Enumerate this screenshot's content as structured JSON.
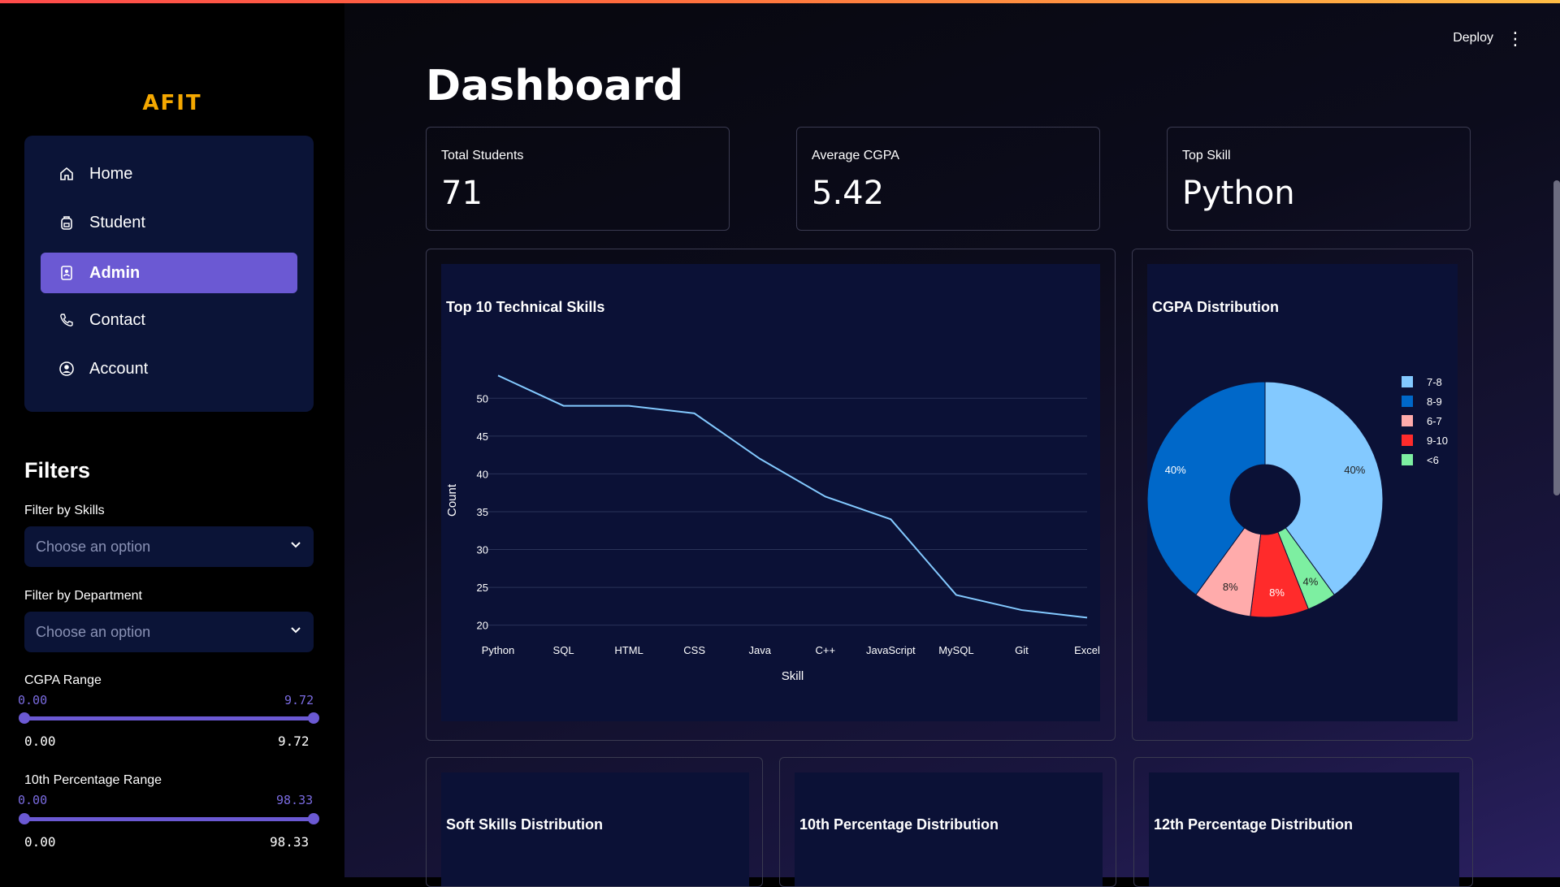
{
  "app": {
    "deploy_label": "Deploy",
    "menu_icon": "more-vertical-icon"
  },
  "sidebar": {
    "logo": "AFIT",
    "nav": [
      {
        "label": "Home",
        "icon": "home-icon"
      },
      {
        "label": "Student",
        "icon": "backpack-icon"
      },
      {
        "label": "Admin",
        "icon": "badge-icon",
        "active": true
      },
      {
        "label": "Contact",
        "icon": "phone-icon"
      },
      {
        "label": "Account",
        "icon": "user-circle-icon"
      }
    ],
    "filters_title": "Filters",
    "skills_filter": {
      "label": "Filter by Skills",
      "placeholder": "Choose an option"
    },
    "dept_filter": {
      "label": "Filter by Department",
      "placeholder": "Choose an option"
    },
    "cgpa_range": {
      "label": "CGPA Range",
      "min": "0.00",
      "max": "9.72"
    },
    "tenth_range": {
      "label": "10th Percentage Range",
      "min": "0.00",
      "max": "98.33"
    }
  },
  "main": {
    "title": "Dashboard",
    "metrics": [
      {
        "label": "Total Students",
        "value": "71"
      },
      {
        "label": "Average CGPA",
        "value": "5.42"
      },
      {
        "label": "Top Skill",
        "value": "Python"
      }
    ],
    "bottom_cards": [
      "Soft Skills Distribution",
      "10th Percentage Distribution",
      "12th Percentage Distribution"
    ]
  },
  "colors": {
    "accent": "#6b59d3",
    "line": "#83c9ff",
    "panel": "#0b1136"
  },
  "chart_data": [
    {
      "type": "line",
      "title": "Top 10 Technical Skills",
      "xlabel": "Skill",
      "ylabel": "Count",
      "categories": [
        "Python",
        "SQL",
        "HTML",
        "CSS",
        "Java",
        "C++",
        "JavaScript",
        "MySQL",
        "Git",
        "Excel"
      ],
      "values": [
        53,
        49,
        49,
        48,
        42,
        37,
        34,
        24,
        22,
        21
      ],
      "ylim": [
        19,
        54
      ],
      "yticks": [
        20,
        25,
        30,
        35,
        40,
        45,
        50
      ],
      "grid": true
    },
    {
      "type": "pie",
      "title": "CGPA Distribution",
      "donut": true,
      "legend_position": "right",
      "slices": [
        {
          "label": "7-8",
          "value": 40,
          "text": "40%",
          "color": "#83c9ff"
        },
        {
          "label": "<6",
          "value": 4,
          "text": "4%",
          "color": "#7defa1"
        },
        {
          "label": "9-10",
          "value": 8,
          "text": "8%",
          "color": "#ff2b2b"
        },
        {
          "label": "6-7",
          "value": 8,
          "text": "8%",
          "color": "#ffabab"
        },
        {
          "label": "8-9",
          "value": 40,
          "text": "40%",
          "color": "#0068c9"
        }
      ],
      "legend_order": [
        "7-8",
        "8-9",
        "6-7",
        "9-10",
        "<6"
      ]
    }
  ]
}
